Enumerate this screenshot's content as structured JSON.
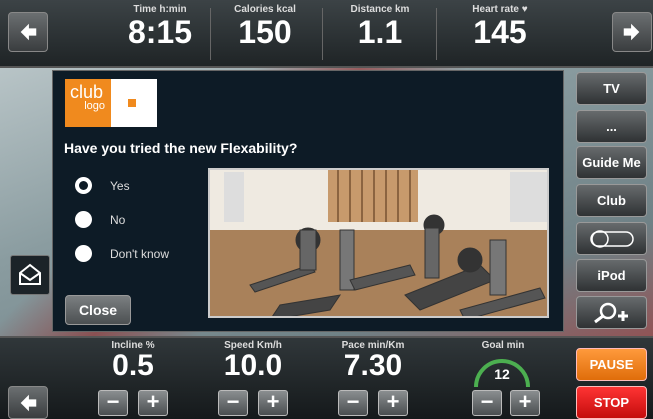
{
  "header": {
    "metrics": [
      {
        "label": "Time h:min",
        "value": "8:15"
      },
      {
        "label": "Calories kcal",
        "value": "150"
      },
      {
        "label": "Distance km",
        "value": "1.1"
      },
      {
        "label": "Heart rate",
        "value": "145"
      }
    ]
  },
  "sidebar": {
    "items": [
      {
        "label": "TV"
      },
      {
        "label": "..."
      },
      {
        "label": "Guide Me"
      },
      {
        "label": "Club"
      },
      {
        "label": "",
        "icon": "toggle-icon"
      },
      {
        "label": "iPod"
      },
      {
        "label": "",
        "icon": "search-plus-icon"
      }
    ],
    "pause_label": "PAUSE",
    "stop_label": "STOP"
  },
  "dialog": {
    "logo_top": "club",
    "logo_bottom": "logo",
    "question": "Have you tried the new Flexability?",
    "options": [
      {
        "label": "Yes",
        "selected": true
      },
      {
        "label": "No",
        "selected": false
      },
      {
        "label": "Don't know",
        "selected": false
      }
    ],
    "close_label": "Close",
    "photo_icon": "fitness-equipment-photo"
  },
  "controls": [
    {
      "label": "Incline %",
      "value": "0.5"
    },
    {
      "label": "Speed Km/h",
      "value": "10.0"
    },
    {
      "label": "Pace min/Km",
      "value": "7.30"
    },
    {
      "label": "Goal min",
      "value": "12"
    }
  ],
  "colors": {
    "accent": "#f08a1e",
    "pause": "#f7861f",
    "stop": "#e31b1b",
    "goal_arc": "#4caf50"
  }
}
